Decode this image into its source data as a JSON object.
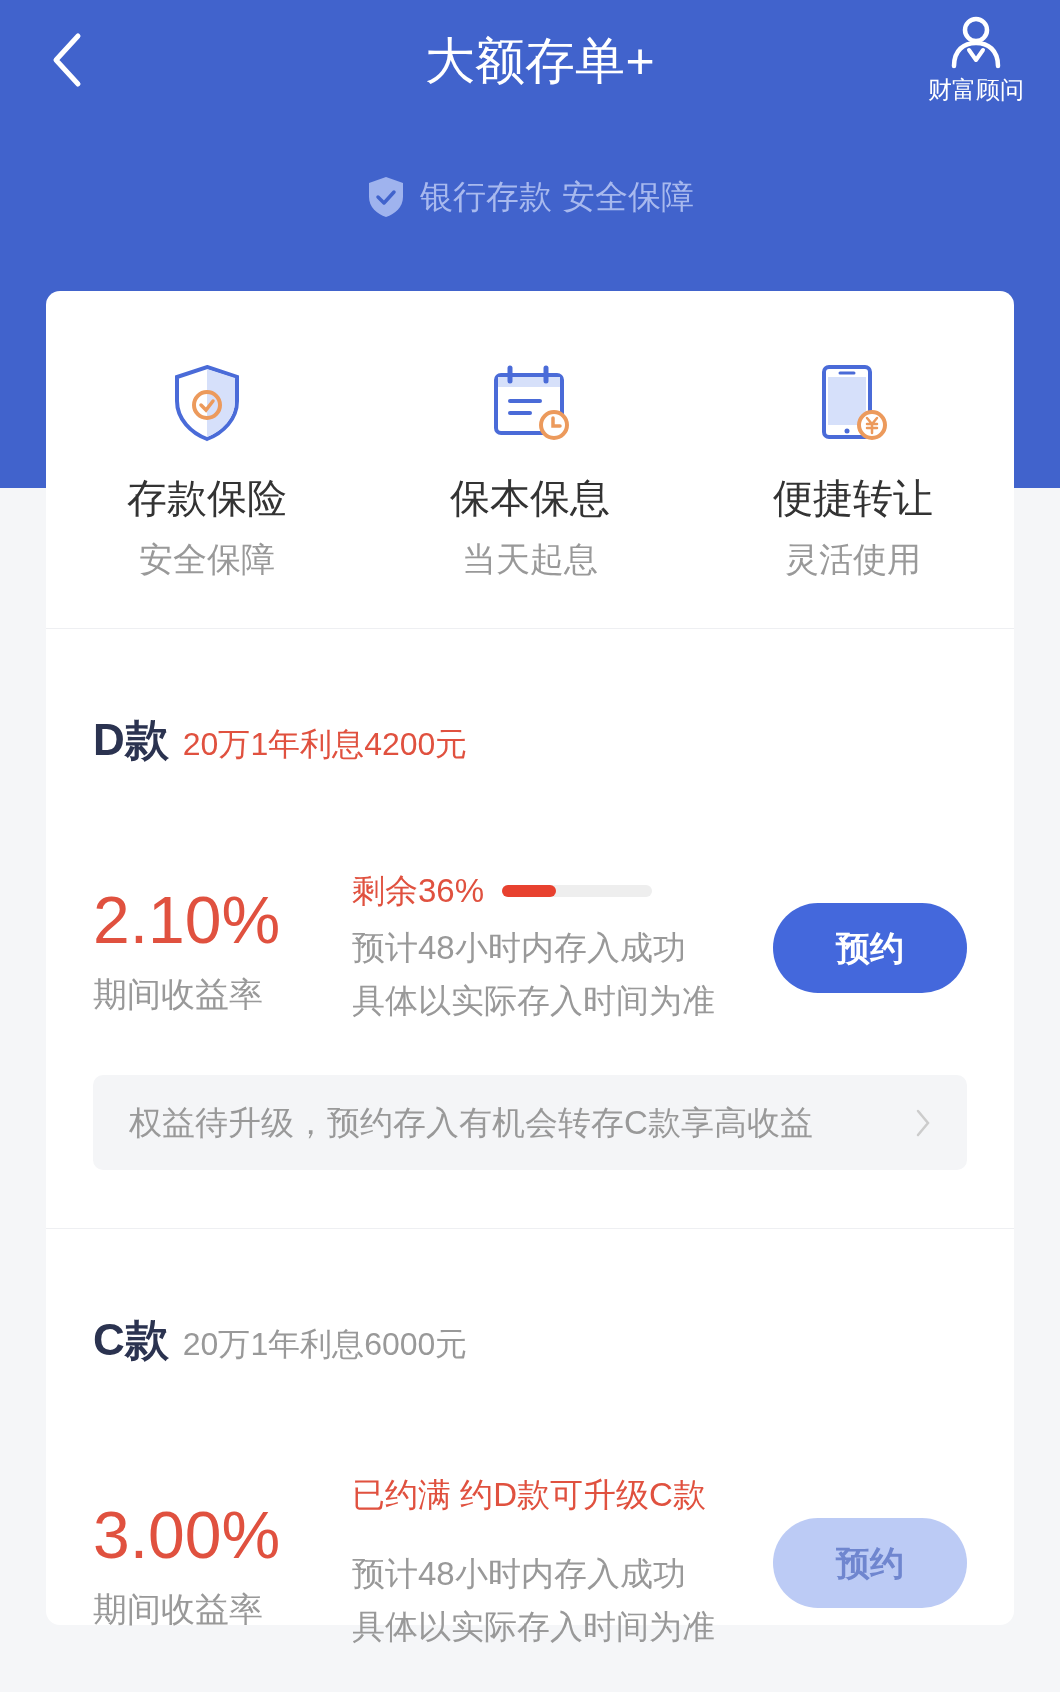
{
  "header": {
    "title": "大额存单+",
    "advisor_label": "财富顾问"
  },
  "banner": "银行存款 安全保障",
  "features": [
    {
      "title": "存款保险",
      "subtitle": "安全保障"
    },
    {
      "title": "保本保息",
      "subtitle": "当天起息"
    },
    {
      "title": "便捷转让",
      "subtitle": "灵活使用"
    }
  ],
  "products": [
    {
      "name": "D款",
      "summary": "20万1年利息4200元",
      "summary_highlighted": true,
      "rate": "2.10%",
      "rate_label": "期间收益率",
      "status": {
        "kind": "progress",
        "text": "剩余36%",
        "level": 0.36
      },
      "notes": [
        "预计48小时内存入成功",
        "具体以实际存入时间为准"
      ],
      "button": {
        "label": "预约",
        "disabled": false
      },
      "notice": "权益待升级，预约存入有机会转存C款享高收益"
    },
    {
      "name": "C款",
      "summary": "20万1年利息6000元",
      "summary_highlighted": false,
      "rate": "3.00%",
      "rate_label": "期间收益率",
      "status": {
        "kind": "text",
        "text": "已约满 约D款可升级C款"
      },
      "notes": [
        "预计48小时内存入成功",
        "具体以实际存入时间为准"
      ],
      "button": {
        "label": "预约",
        "disabled": true
      }
    }
  ]
}
